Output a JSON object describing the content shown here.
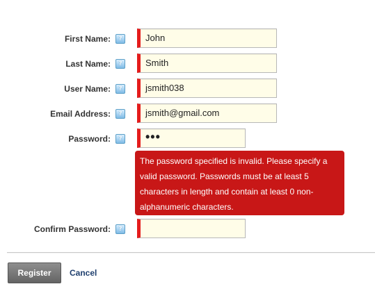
{
  "form": {
    "first_name": {
      "label": "First Name:",
      "value": "John"
    },
    "last_name": {
      "label": "Last Name:",
      "value": "Smith"
    },
    "user_name": {
      "label": "User Name:",
      "value": "jsmith038"
    },
    "email": {
      "label": "Email Address:",
      "value": "jsmith@gmail.com"
    },
    "password": {
      "label": "Password:",
      "value": "•••"
    },
    "confirm_password": {
      "label": "Confirm Password:",
      "value": ""
    },
    "help_icon_glyph": "?",
    "password_error": "The password specified is invalid. Please specify a valid password. Passwords must be at least 5 characters in length and contain at least 0 non-alphanumeric characters."
  },
  "actions": {
    "register_label": "Register",
    "cancel_label": "Cancel"
  },
  "icons": {
    "help": "help-icon"
  },
  "colors": {
    "required_marker": "#e51c1c",
    "error_background": "#c81717",
    "input_background": "#fffde8",
    "cancel_link": "#1f3f6e"
  }
}
